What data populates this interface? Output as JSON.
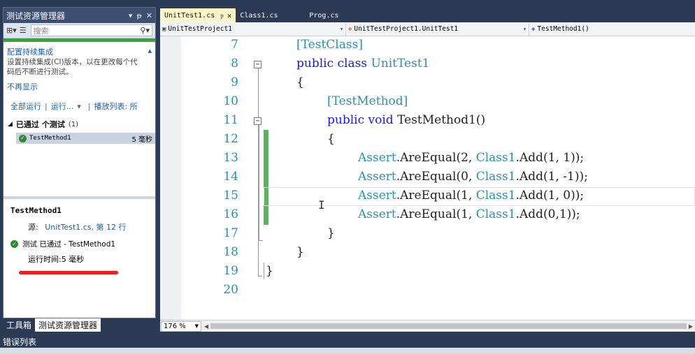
{
  "test_explorer": {
    "title": "测试资源管理器",
    "title_controls": [
      "▾",
      "ᵽ",
      "✕"
    ],
    "search_placeholder": "搜索",
    "notice": {
      "heading": "配置持续集成",
      "description_line1": "设置持续集成(CI)版本，以在更改每个代",
      "description_line2": "码后不断进行测试。",
      "dismiss": "不再显示"
    },
    "run_bar": {
      "run_all": "全部运行",
      "run": "运行...",
      "playlist": "播放列表: 所"
    },
    "group": {
      "label": "已通过",
      "label_rest": "个测试",
      "count": "(1)"
    },
    "tests": [
      {
        "name": "TestMethod1",
        "duration": "5 毫秒",
        "status": "passed"
      }
    ],
    "detail": {
      "title": "TestMethod1",
      "source_label": "源:",
      "source_link": "UnitTest1.cs, 第 12 行",
      "result": "测试 已通过 - TestMethod1",
      "elapsed": "运行时间:5 毫秒"
    },
    "bottom_tabs": [
      "工具箱",
      "测试资源管理器"
    ]
  },
  "editor": {
    "tabs": [
      {
        "label": "UnitTest1.cs",
        "active": true
      },
      {
        "label": "Class1.cs",
        "active": false
      },
      {
        "label": "Prog.cs",
        "active": false
      }
    ],
    "navigation": {
      "project": "UnitTestProject1",
      "class": "UnitTestProject1.UnitTest1",
      "member": "TestMethod1()"
    },
    "lines": [
      {
        "n": "7",
        "text": "[TestClass]"
      },
      {
        "n": "8",
        "text": "public class UnitTest1"
      },
      {
        "n": "9",
        "text": "{"
      },
      {
        "n": "10",
        "text": "[TestMethod]"
      },
      {
        "n": "11",
        "text": "public void TestMethod1()"
      },
      {
        "n": "12",
        "text": "{"
      },
      {
        "n": "13",
        "text": "Assert.AreEqual(2, Class1.Add(1, 1));"
      },
      {
        "n": "14",
        "text": "Assert.AreEqual(0, Class1.Add(1, -1));"
      },
      {
        "n": "15",
        "text": "Assert.AreEqual(1, Class1.Add(1, 0));"
      },
      {
        "n": "16",
        "text": "Assert.AreEqual(1, Class1.Add(0,1));"
      },
      {
        "n": "17",
        "text": "}"
      },
      {
        "n": "18",
        "text": "}"
      },
      {
        "n": "19",
        "text": "}"
      },
      {
        "n": "20",
        "text": ""
      }
    ],
    "zoom": "176 %"
  },
  "error_list": {
    "title": "错误列表"
  },
  "colors": {
    "keyword": "#1a1ae6",
    "type": "#2b91af",
    "pass_green": "#2e8b2e",
    "change_bar": "#56b75a",
    "annotation_red": "#ef1c1c"
  }
}
